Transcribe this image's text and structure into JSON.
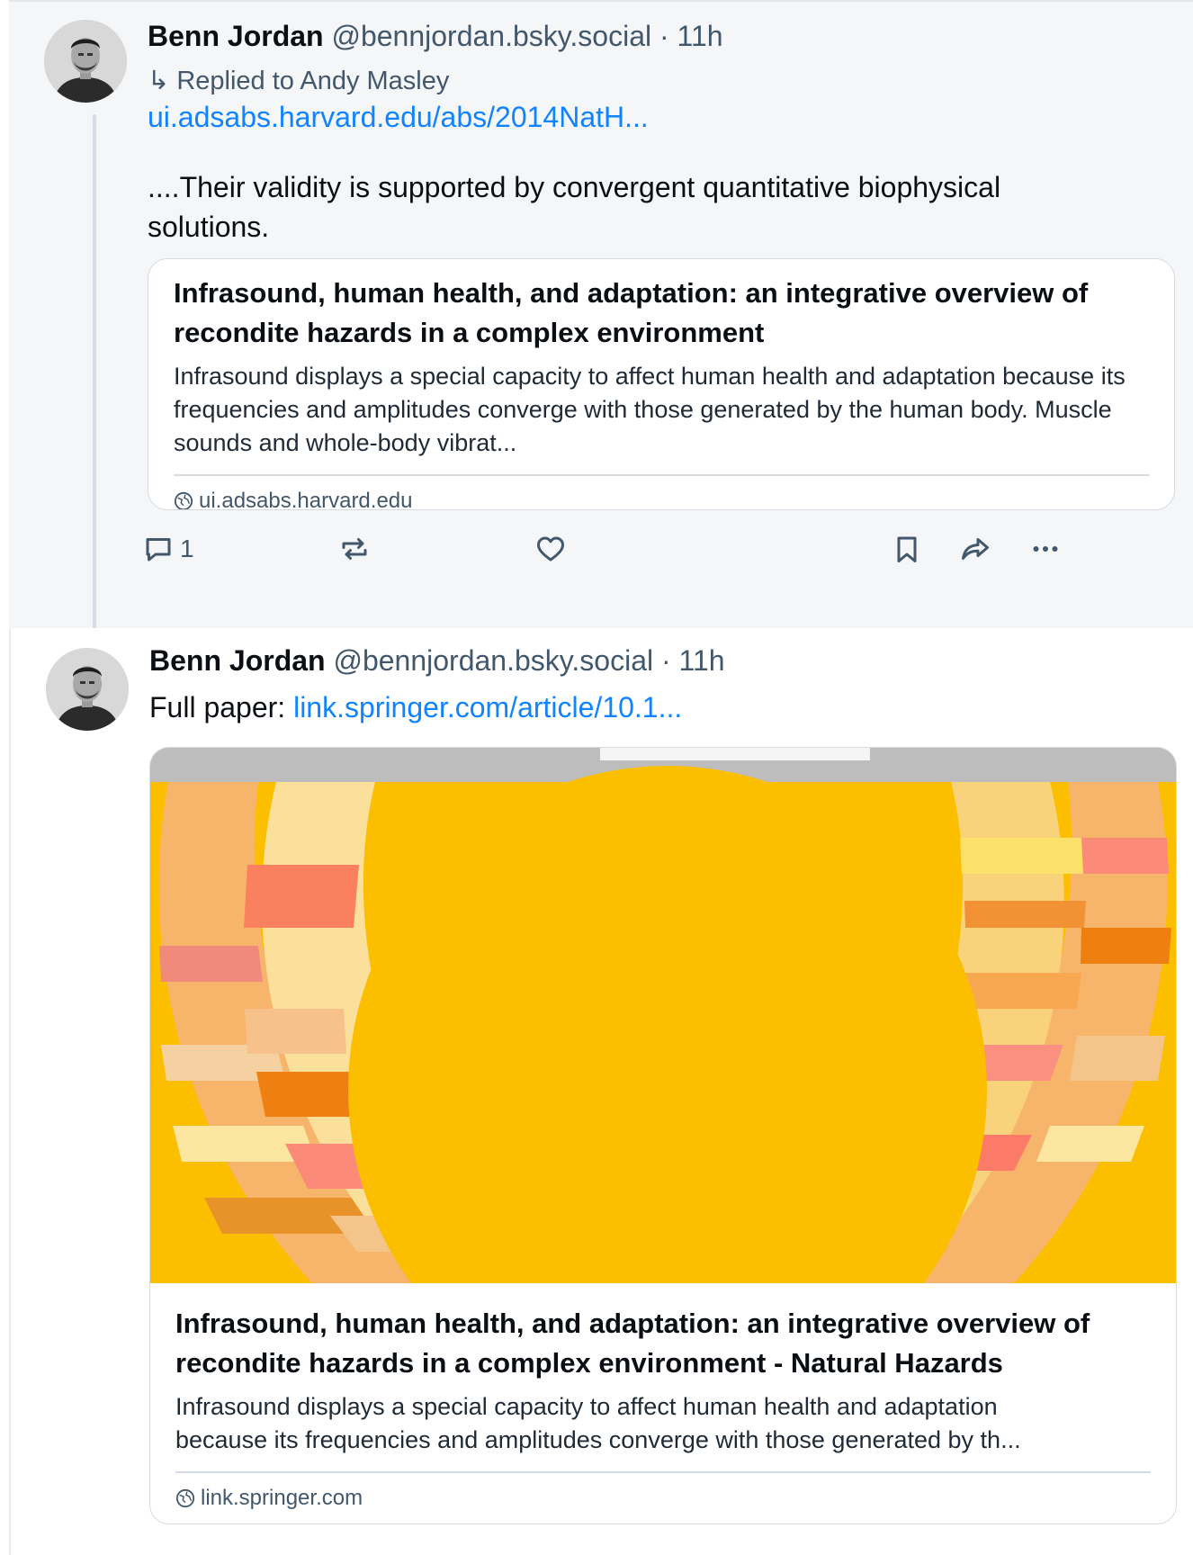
{
  "post1": {
    "author": "Benn Jordan",
    "handle": "@bennjordan.bsky.social",
    "time": "11h",
    "reply_prefix": "Replied to Andy Masley",
    "link_text": "ui.adsabs.harvard.edu/abs/2014NatH...",
    "body": "....Their validity is supported by convergent quantitative biophysical solutions.",
    "card": {
      "title": "Infrasound, human health, and adaptation: an integrative overview of recondite hazards in a complex environment",
      "description": "Infrasound displays a special capacity to affect human health and adaptation because its frequencies and amplitudes converge with those generated by the human body. Muscle sounds and whole-body vibrat...",
      "domain": "ui.adsabs.harvard.edu",
      "domain_icon": "globe-icon"
    },
    "actions": {
      "reply_count": "1",
      "icons": [
        "reply-icon",
        "repost-icon",
        "like-icon",
        "bookmark-icon",
        "share-icon",
        "more-icon"
      ]
    }
  },
  "post2": {
    "author": "Benn Jordan",
    "handle": "@bennjordan.bsky.social",
    "time": "11h",
    "prefix": "Full paper:",
    "link_text": "link.springer.com/article/10.1...",
    "card": {
      "title": "Infrasound, human health, and adaptation: an integrative overview of recondite hazards in a complex environment - Natural Hazards",
      "description": "Infrasound displays a special capacity to affect human health and adaptation because its frequencies and amplitudes converge with those generated by th...",
      "domain": "link.springer.com",
      "domain_icon": "globe-icon"
    }
  },
  "colors": {
    "link": "#1083fe",
    "muted": "#42576c",
    "thread_bg": "#f4f6f8",
    "banner_yellow": "#fbbf00"
  }
}
